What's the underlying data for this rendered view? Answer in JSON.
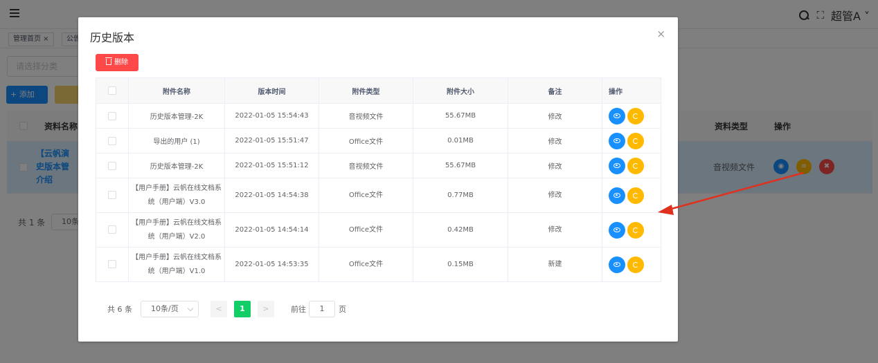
{
  "topbar": {
    "user": "超管A"
  },
  "tags": [
    {
      "label": "管理首页 ×"
    },
    {
      "label": "公告"
    }
  ],
  "bg": {
    "select_placeholder": "请选择分类",
    "add_label": "+ 添加",
    "header_name": "资料名称",
    "header_type": "资料类型",
    "header_ops": "操作",
    "row_name": "【云帆演史版本管介绍",
    "row_type": "音视频文件",
    "total": "共 1 条",
    "page_size": "10条"
  },
  "dialog": {
    "title": "历史版本",
    "close": "×",
    "delete_label": "删除",
    "columns": [
      "附件名称",
      "版本时间",
      "附件类型",
      "附件大小",
      "备注",
      "操作"
    ],
    "rows": [
      {
        "name": "历史版本管理-2K",
        "time": "2022-01-05 15:54:43",
        "type": "音视频文件",
        "size": "55.67MB",
        "note": "修改"
      },
      {
        "name": "导出的用户 (1)",
        "time": "2022-01-05 15:51:47",
        "type": "Office文件",
        "size": "0.01MB",
        "note": "修改"
      },
      {
        "name": "历史版本管理-2K",
        "time": "2022-01-05 15:51:12",
        "type": "音视频文件",
        "size": "55.67MB",
        "note": "修改"
      },
      {
        "name": "【用户手册】云帆在线文档系统（用户端）V3.0",
        "time": "2022-01-05 14:54:38",
        "type": "Office文件",
        "size": "0.77MB",
        "note": "修改"
      },
      {
        "name": "【用户手册】云帆在线文档系统（用户端）V2.0",
        "time": "2022-01-05 14:54:14",
        "type": "Office文件",
        "size": "0.42MB",
        "note": "修改"
      },
      {
        "name": "【用户手册】云帆在线文档系统（用户端）V1.0",
        "time": "2022-01-05 14:53:35",
        "type": "Office文件",
        "size": "0.15MB",
        "note": "新建"
      }
    ],
    "pager": {
      "total": "共 6 条",
      "page_size": "10条/页",
      "prev": "<",
      "current": "1",
      "next": ">",
      "goto_label": "前往",
      "goto_value": "1",
      "page_suffix": "页"
    }
  },
  "colors": {
    "primary": "#1890ff",
    "danger": "#ff4949",
    "warning": "#ffba00",
    "success": "#13ce66",
    "annotation_arrow": "#e0301e"
  }
}
